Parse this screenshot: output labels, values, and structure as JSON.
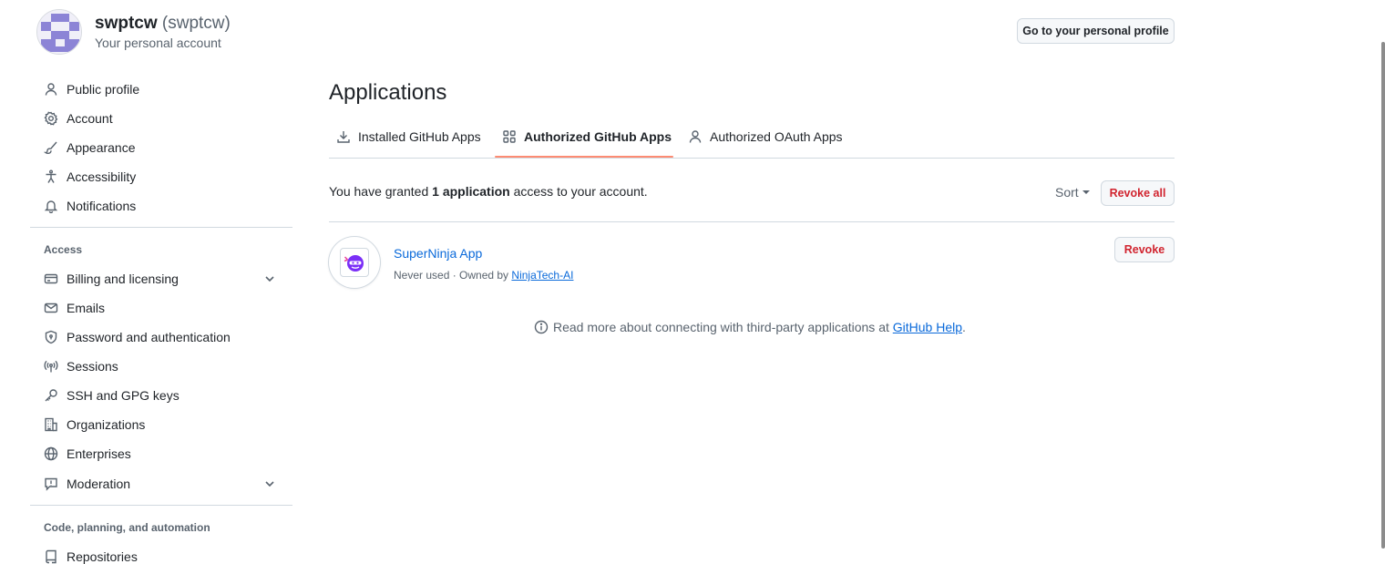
{
  "account": {
    "display_name": "swptcw",
    "login": "(swptcw)",
    "subtitle": "Your personal account",
    "profile_button": "Go to your personal profile"
  },
  "sidebar": {
    "items_top": [
      {
        "label": "Public profile",
        "icon": "person-icon"
      },
      {
        "label": "Account",
        "icon": "gear-icon"
      },
      {
        "label": "Appearance",
        "icon": "paintbrush-icon"
      },
      {
        "label": "Accessibility",
        "icon": "accessibility-icon"
      },
      {
        "label": "Notifications",
        "icon": "bell-icon"
      }
    ],
    "access_heading": "Access",
    "items_access": [
      {
        "label": "Billing and licensing",
        "icon": "credit-card-icon"
      },
      {
        "label": "Emails",
        "icon": "mail-icon"
      },
      {
        "label": "Password and authentication",
        "icon": "shield-lock-icon"
      },
      {
        "label": "Sessions",
        "icon": "broadcast-icon"
      },
      {
        "label": "SSH and GPG keys",
        "icon": "key-icon"
      },
      {
        "label": "Organizations",
        "icon": "organization-icon"
      },
      {
        "label": "Enterprises",
        "icon": "globe-icon"
      },
      {
        "label": "Moderation",
        "icon": "report-icon"
      }
    ],
    "code_heading": "Code, planning, and automation",
    "items_code": [
      {
        "label": "Repositories",
        "icon": "repo-icon"
      }
    ]
  },
  "main": {
    "title": "Applications",
    "tabs": [
      {
        "label": "Installed GitHub Apps",
        "icon": "download-icon"
      },
      {
        "label": "Authorized GitHub Apps",
        "icon": "apps-icon"
      },
      {
        "label": "Authorized OAuth Apps",
        "icon": "person-icon"
      }
    ],
    "active_tab": "Authorized GitHub Apps",
    "granted_prefix": "You have granted",
    "granted_count": "1 application",
    "granted_suffix": "access to your account.",
    "sort_label": "Sort",
    "revoke_all_label": "Revoke all",
    "apps": [
      {
        "name": "SuperNinja App",
        "usage": "Never used · Owned by",
        "owner": "NinjaTech-AI",
        "revoke_label": "Revoke"
      }
    ],
    "help_text": "Read more about connecting with third-party applications at",
    "help_link": "GitHub Help",
    "help_end": "."
  },
  "colors": {
    "link": "#0969da",
    "danger": "#d1242f",
    "tab_underline": "#fd8c73",
    "avatar": "#8c84d6"
  }
}
